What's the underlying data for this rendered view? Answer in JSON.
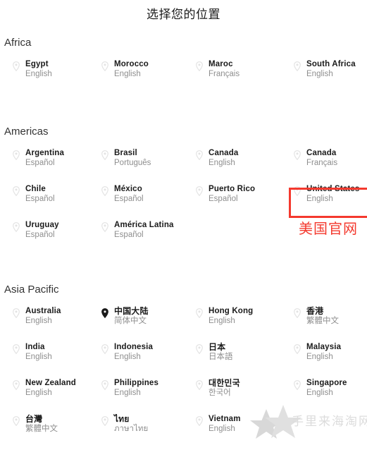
{
  "page": {
    "title": "选择您的位置",
    "background": "#ffffff"
  },
  "icons": {
    "pin": "location-pin-icon",
    "pin_active": "location-pin-filled-icon",
    "star": "star-icon"
  },
  "colors": {
    "name_text": "#1a1a1a",
    "language_text": "#8e8e8e",
    "pin_inactive": "#e3e3e3",
    "pin_active": "#1a1a1a",
    "annotation_red": "#f4392e",
    "watermark_gray": "#dcdcdc"
  },
  "annotation": {
    "label": "美国官网",
    "target": "United States",
    "box_color": "#f4392e"
  },
  "watermark": {
    "text": "手里来海淘网"
  },
  "regions": [
    {
      "name": "Africa",
      "rows": [
        [
          {
            "country": "Egypt",
            "language": "English",
            "active": false
          },
          {
            "country": "Morocco",
            "language": "English",
            "active": false
          },
          {
            "country": "Maroc",
            "language": "Français",
            "active": false
          },
          {
            "country": "South Africa",
            "language": "English",
            "active": false
          }
        ]
      ]
    },
    {
      "name": "Americas",
      "rows": [
        [
          {
            "country": "Argentina",
            "language": "Español",
            "active": false
          },
          {
            "country": "Brasil",
            "language": "Português",
            "active": false
          },
          {
            "country": "Canada",
            "language": "English",
            "active": false
          },
          {
            "country": "Canada",
            "language": "Français",
            "active": false
          }
        ],
        [
          {
            "country": "Chile",
            "language": "Español",
            "active": false
          },
          {
            "country": "México",
            "language": "Español",
            "active": false
          },
          {
            "country": "Puerto Rico",
            "language": "Español",
            "active": false
          },
          {
            "country": "United States",
            "language": "English",
            "active": false,
            "highlighted": true
          }
        ],
        [
          {
            "country": "Uruguay",
            "language": "Español",
            "active": false
          },
          {
            "country": "América Latina",
            "language": "Español",
            "active": false
          }
        ]
      ]
    },
    {
      "name": "Asia Pacific",
      "rows": [
        [
          {
            "country": "Australia",
            "language": "English",
            "active": false
          },
          {
            "country": "中国大陆",
            "language": "简体中文",
            "active": true,
            "cjk": true
          },
          {
            "country": "Hong Kong",
            "language": "English",
            "active": false
          },
          {
            "country": "香港",
            "language": "繁體中文",
            "active": false,
            "cjk": true
          }
        ],
        [
          {
            "country": "India",
            "language": "English",
            "active": false
          },
          {
            "country": "Indonesia",
            "language": "English",
            "active": false
          },
          {
            "country": "日本",
            "language": "日本語",
            "active": false,
            "cjk": true
          },
          {
            "country": "Malaysia",
            "language": "English",
            "active": false
          }
        ],
        [
          {
            "country": "New Zealand",
            "language": "English",
            "active": false
          },
          {
            "country": "Philippines",
            "language": "English",
            "active": false
          },
          {
            "country": "대한민국",
            "language": "한국어",
            "active": false,
            "cjk": true
          },
          {
            "country": "Singapore",
            "language": "English",
            "active": false
          }
        ],
        [
          {
            "country": "台灣",
            "language": "繁體中文",
            "active": false,
            "cjk": true
          },
          {
            "country": "ไทย",
            "language": "ภาษาไทย",
            "active": false,
            "cjk": true
          },
          {
            "country": "Vietnam",
            "language": "English",
            "active": false
          }
        ]
      ]
    }
  ]
}
